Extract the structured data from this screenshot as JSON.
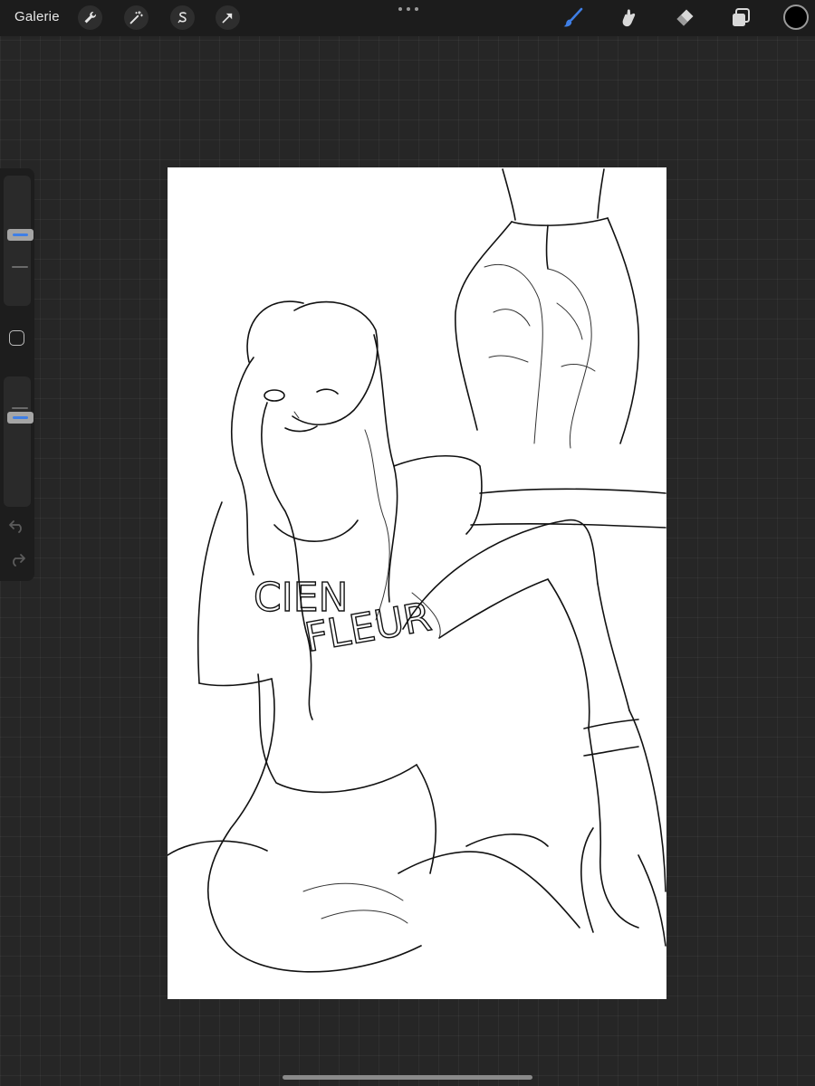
{
  "topbar": {
    "gallery_label": "Galerie",
    "left_tools": [
      {
        "name": "actions",
        "icon": "wrench-icon"
      },
      {
        "name": "adjustments",
        "icon": "magic-wand-icon"
      },
      {
        "name": "selection",
        "icon": "selection-s-icon"
      },
      {
        "name": "transform",
        "icon": "arrow-cursor-icon"
      }
    ],
    "right_tools": [
      {
        "name": "paint",
        "icon": "brush-icon",
        "active": true,
        "color": "#3f7fe6"
      },
      {
        "name": "smudge",
        "icon": "smudge-finger-icon",
        "active": false
      },
      {
        "name": "erase",
        "icon": "eraser-icon",
        "active": false
      },
      {
        "name": "layers",
        "icon": "layers-icon",
        "active": false
      }
    ],
    "current_color": "#000000"
  },
  "sidebar": {
    "brush_size_level": 0.55,
    "opacity_level": 0.7,
    "undo_icon": "undo-arrow-icon",
    "redo_icon": "redo-arrow-icon",
    "modify_icon": "square-modify-icon"
  },
  "canvas": {
    "background": "#ffffff",
    "shirt_lettering_line1": "CIEN",
    "shirt_lettering_line2": "FLEUR"
  },
  "accent_color": "#3f7fe6"
}
